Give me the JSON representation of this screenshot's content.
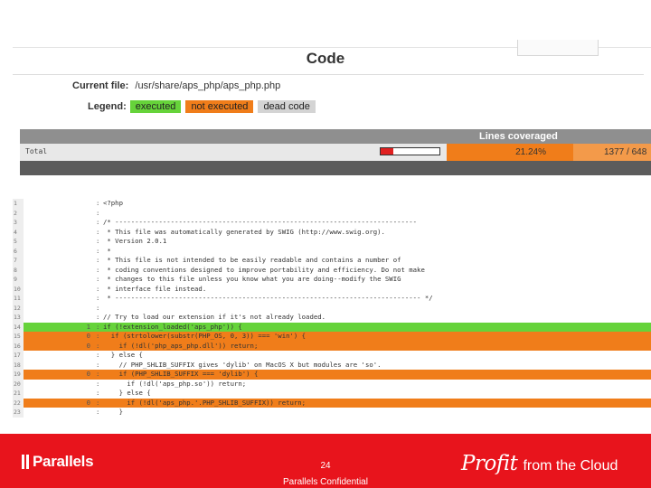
{
  "header": {
    "title": "Code",
    "current_file_label": "Current file:",
    "current_file_path": "/usr/share/aps_php/aps_php.php",
    "legend_label": "Legend:",
    "legend": [
      {
        "key": "executed",
        "label": "executed",
        "color": "#66d33a"
      },
      {
        "key": "not_executed",
        "label": "not executed",
        "color": "#f07d1a"
      },
      {
        "key": "dead",
        "label": "dead code",
        "color": "#d4d4d4"
      }
    ]
  },
  "coverage": {
    "header_label": "Lines coveraged",
    "row_name": "Total",
    "percent_text": "21.24%",
    "percent_value": 21.24,
    "count_text": "1377 / 648",
    "bar_fill_color": "#e02020"
  },
  "code_lines": [
    {
      "num": "1",
      "count": "",
      "src": "<?php",
      "status": ""
    },
    {
      "num": "2",
      "count": "",
      "src": "",
      "status": ""
    },
    {
      "num": "3",
      "count": "",
      "src": "/* ----------------------------------------------------------------------------",
      "status": ""
    },
    {
      "num": "4",
      "count": "",
      "src": " * This file was automatically generated by SWIG (http://www.swig.org).",
      "status": ""
    },
    {
      "num": "5",
      "count": "",
      "src": " * Version 2.0.1",
      "status": ""
    },
    {
      "num": "6",
      "count": "",
      "src": " *",
      "status": ""
    },
    {
      "num": "7",
      "count": "",
      "src": " * This file is not intended to be easily readable and contains a number of",
      "status": ""
    },
    {
      "num": "8",
      "count": "",
      "src": " * coding conventions designed to improve portability and efficiency. Do not make",
      "status": ""
    },
    {
      "num": "9",
      "count": "",
      "src": " * changes to this file unless you know what you are doing--modify the SWIG",
      "status": ""
    },
    {
      "num": "10",
      "count": "",
      "src": " * interface file instead.",
      "status": ""
    },
    {
      "num": "11",
      "count": "",
      "src": " * ----------------------------------------------------------------------------- */",
      "status": ""
    },
    {
      "num": "12",
      "count": "",
      "src": "",
      "status": ""
    },
    {
      "num": "13",
      "count": "",
      "src": "// Try to load our extension if it's not already loaded.",
      "status": ""
    },
    {
      "num": "14",
      "count": "1",
      "src": "if (!extension_loaded('aps_php')) {",
      "status": "executed"
    },
    {
      "num": "15",
      "count": "0",
      "src": "  if (strtolower(substr(PHP_OS, 0, 3)) === 'win') {",
      "status": "not_executed"
    },
    {
      "num": "16",
      "count": "0",
      "src": "    if (!dl('php_aps_php.dll')) return;",
      "status": "not_executed"
    },
    {
      "num": "17",
      "count": "",
      "src": "  } else {",
      "status": ""
    },
    {
      "num": "18",
      "count": "",
      "src": "    // PHP_SHLIB_SUFFIX gives 'dylib' on MacOS X but modules are 'so'.",
      "status": ""
    },
    {
      "num": "19",
      "count": "0",
      "src": "    if (PHP_SHLIB_SUFFIX === 'dylib') {",
      "status": "not_executed"
    },
    {
      "num": "20",
      "count": "",
      "src": "      if (!dl('aps_php.so')) return;",
      "status": ""
    },
    {
      "num": "21",
      "count": "",
      "src": "    } else {",
      "status": ""
    },
    {
      "num": "22",
      "count": "0",
      "src": "      if (!dl('aps_php.'.PHP_SHLIB_SUFFIX)) return;",
      "status": "not_executed"
    },
    {
      "num": "23",
      "count": "",
      "src": "    }",
      "status": ""
    }
  ],
  "footer": {
    "logo_text": "Parallels",
    "page_number": "24",
    "confidential": "Parallels Confidential",
    "tagline_profit": "Profit",
    "tagline_rest": "from the Cloud",
    "brand_color": "#e8141c"
  }
}
